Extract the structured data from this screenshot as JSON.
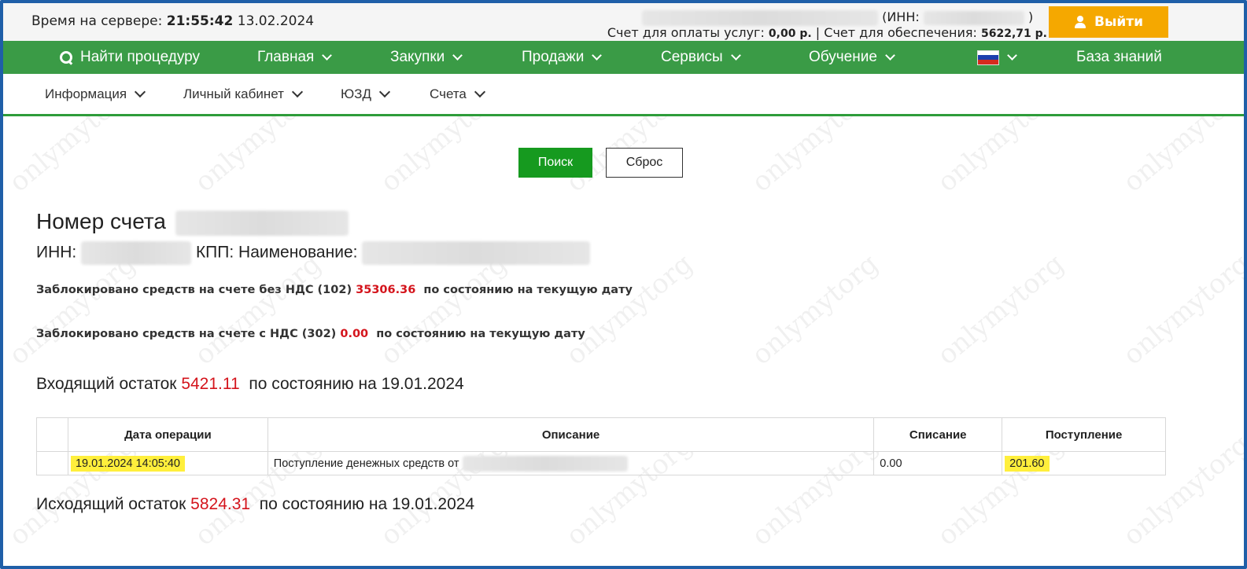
{
  "topbar": {
    "server_time_label": "Время на сервере:",
    "server_time": "21:55:42",
    "server_date": "13.02.2024",
    "inn_prefix": "(ИНН:",
    "inn_suffix": ")",
    "services_account_label": "Счет для оплаты услуг:",
    "services_account_value": "0,00 р.",
    "separator": "|",
    "security_account_label": "Счет для обеспечения:",
    "security_account_value": "5622,71 р.",
    "logout_label": "Выйти"
  },
  "mainnav": {
    "find_procedure": "Найти процедуру",
    "items": [
      "Главная",
      "Закупки",
      "Продажи",
      "Сервисы",
      "Обучение"
    ],
    "knowledge_base": "База знаний",
    "flag_colors": [
      "#ffffff",
      "#1c3fae",
      "#d52b1e"
    ]
  },
  "subnav": {
    "items": [
      "Информация",
      "Личный кабинет",
      "ЮЗД",
      "Счета"
    ]
  },
  "actions": {
    "search_label": "Поиск",
    "reset_label": "Сброс"
  },
  "account": {
    "title": "Номер счета",
    "inn_label": "ИНН:",
    "kpp_name_label": "КПП: Наименование:",
    "blocked_no_vat_label": "Заблокировано средств на счете без НДС (102)",
    "blocked_no_vat_value": "35306.36",
    "blocked_vat_label": "Заблокировано средств на счете с НДС (302)",
    "blocked_vat_value": "0.00",
    "as_of_current": "по состоянию на текущую дату",
    "opening_label": "Входящий остаток",
    "opening_value": "5421.11",
    "opening_as_of": "по состоянию на 19.01.2024",
    "closing_label": "Исходящий остаток",
    "closing_value": "5824.31",
    "closing_as_of": "по состоянию на 19.01.2024"
  },
  "table": {
    "headers": [
      "",
      "Дата операции",
      "Описание",
      "Списание",
      "Поступление"
    ],
    "rows": [
      {
        "date": "19.01.2024 14:05:40",
        "description": "Поступление денежных средств от",
        "debit": "0.00",
        "credit": "201.60"
      }
    ]
  },
  "watermark": "onlymytorg",
  "colors": {
    "nav_green": "#3a9b46",
    "search_button": "#169a1f",
    "logout_orange": "#f5a800",
    "amount_red": "#d4141c",
    "highlight_yellow": "#ffef3c",
    "frame_blue": "#1f5fa8"
  }
}
